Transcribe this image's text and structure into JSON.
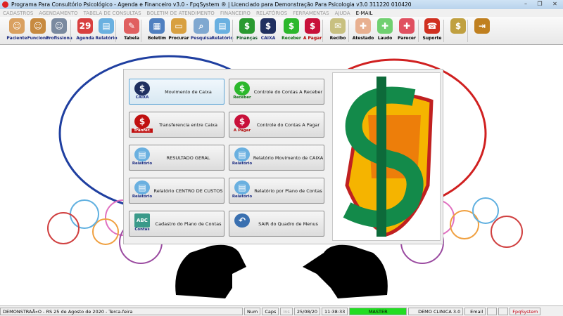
{
  "window": {
    "title": "Programa Para Consultório Psicológico - Agenda e Financeiro v3.0 - FpqSystem ® | Licenciado para  Demonstração Para Psicologia v3.0 311220 010420",
    "minimize": "–",
    "maximize": "❐",
    "close": "✕"
  },
  "menu": [
    "CADASTROS",
    "AGENDAMENTO",
    "TABELA DE CONSULTAS",
    "BOLETIM DE ATENDIMENTO",
    "FINANCEIRO",
    "RELATÓRIOS",
    "FERRAMENTAS",
    "AJUDA"
  ],
  "menu_email": "E-MAIL",
  "toolbar": [
    {
      "label": "Paciente",
      "color": "#1a2a80",
      "icon": "#d9a060",
      "glyph": "☺"
    },
    {
      "label": "Funciona",
      "color": "#1a2a80",
      "icon": "#c78a40",
      "glyph": "☺"
    },
    {
      "label": "Profissiona",
      "color": "#1a2a80",
      "icon": "#7a8aa0",
      "glyph": "☺"
    },
    {
      "label": "Agenda",
      "color": "#1a2a80",
      "icon": "#d84040",
      "glyph": "29"
    },
    {
      "label": "Relatório",
      "color": "#1a2a80",
      "icon": "#6ab0e0",
      "glyph": "▤"
    },
    {
      "label": "Tabela",
      "color": "#000",
      "icon": "#e06060",
      "glyph": "✎"
    },
    {
      "label": "Boletim",
      "color": "#000",
      "icon": "#5080c0",
      "glyph": "▦"
    },
    {
      "label": "Procurar",
      "color": "#000",
      "icon": "#d8a040",
      "glyph": "▭"
    },
    {
      "label": "Pesquisa",
      "color": "#1a2a80",
      "icon": "#80a8d0",
      "glyph": "⌕"
    },
    {
      "label": "Relatório",
      "color": "#1a2a80",
      "icon": "#6ab0e0",
      "glyph": "▤"
    },
    {
      "label": "Finanças",
      "color": "#0a5020",
      "icon": "#2a9a30",
      "glyph": "$"
    },
    {
      "label": "CAIXA",
      "color": "#1a2a80",
      "icon": "#203060",
      "glyph": "$"
    },
    {
      "label": "Receber",
      "color": "#0a6a10",
      "icon": "#2cb82c",
      "glyph": "$"
    },
    {
      "label": "A Pagar",
      "color": "#b00000",
      "icon": "#c8103a",
      "glyph": "$"
    },
    {
      "label": "Recibo",
      "color": "#000",
      "icon": "#c8c080",
      "glyph": "✉"
    },
    {
      "label": "Atestado",
      "color": "#000",
      "icon": "#e8b090",
      "glyph": "✚"
    },
    {
      "label": "Laudo",
      "color": "#000",
      "icon": "#70d070",
      "glyph": "✚"
    },
    {
      "label": "Parecer",
      "color": "#000",
      "icon": "#e05060",
      "glyph": "✚"
    },
    {
      "label": "Suporte",
      "color": "#000",
      "icon": "#d03020",
      "glyph": "☎"
    },
    {
      "label": "",
      "color": "#000",
      "icon": "#c0a040",
      "glyph": "$"
    },
    {
      "label": "",
      "color": "#000",
      "icon": "#c08020",
      "glyph": "⇥"
    }
  ],
  "panel": {
    "buttons": [
      {
        "label": "Movimento de Caixa",
        "caption": "CAIXA",
        "capColor": "#1a2a80",
        "symColor": "#203060",
        "glyph": "$"
      },
      {
        "label": "Controle do Contas A Receber",
        "caption": "Receber",
        "capColor": "#0a6a10",
        "symColor": "#2cb82c",
        "glyph": "$"
      },
      {
        "label": "Transferencia entre Caixa",
        "caption": "Tranfer.",
        "capColor": "#fff",
        "symColor": "#c01010",
        "glyph": "$"
      },
      {
        "label": "Controle do Contas A Pagar",
        "caption": "A Pagar",
        "capColor": "#b00000",
        "symColor": "#c8103a",
        "glyph": "$"
      },
      {
        "label": "RESULTADO GERAL",
        "caption": "Relatório",
        "capColor": "#1a2a80",
        "symColor": "#6ab0e0",
        "glyph": "▤"
      },
      {
        "label": "Relatório Movimento de CAIXA",
        "caption": "Relatório",
        "capColor": "#1a2a80",
        "symColor": "#6ab0e0",
        "glyph": "▤"
      },
      {
        "label": "Relatório CENTRO DE CUSTOS",
        "caption": "Relatório",
        "capColor": "#1a2a80",
        "symColor": "#6ab0e0",
        "glyph": "▤"
      },
      {
        "label": "Relatório por Plano de Contas",
        "caption": "Relatório",
        "capColor": "#1a2a80",
        "symColor": "#6ab0e0",
        "glyph": "▤"
      },
      {
        "label": "Cadastro do Plano de Contas",
        "caption": "Contas",
        "capColor": "#1a2a80",
        "symColor": "#3a9a8a",
        "glyph": "ABC"
      },
      {
        "label": "SAIR do Quadro de Menus",
        "caption": "",
        "capColor": "#1a2a80",
        "symColor": "#3a70b0",
        "glyph": "↶"
      }
    ]
  },
  "status": {
    "text": "DEMONSTRAÃ«O - RS 25 de Agosto de 2020 - Terca-feira",
    "num": "Num",
    "caps": "Caps",
    "ins": "Ins",
    "date": "25/08/20",
    "time": "11:38:33",
    "user": "MASTER",
    "clinic": "DEMO CLINICA 3.0",
    "email": "Email",
    "brand": "FpqSystem"
  }
}
